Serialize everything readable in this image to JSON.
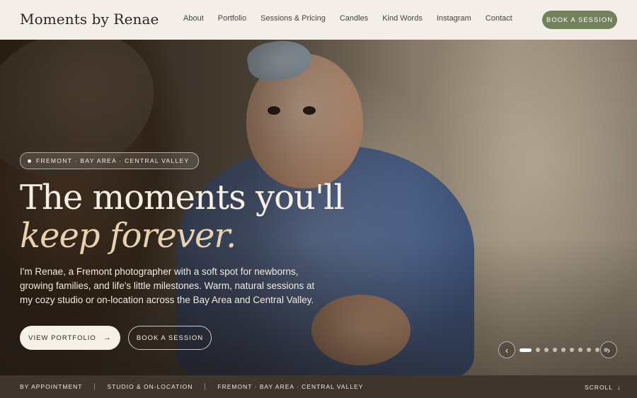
{
  "header": {
    "brand": "Moments by Renae",
    "nav": [
      "About",
      "Portfolio",
      "Sessions & Pricing",
      "Candles",
      "Kind Words",
      "Instagram",
      "Contact"
    ],
    "cta": "BOOK A SESSION"
  },
  "hero": {
    "location": "FREMONT · BAY AREA · CENTRAL VALLEY",
    "headline": "The moments you'll",
    "headline_italic": "keep forever.",
    "intro": "I'm Renae, a Fremont photographer with a soft spot for newborns, growing families, and life's little milestones. Warm, natural sessions at my cozy studio or on-location across the Bay Area and Central Valley.",
    "primary_button": "VIEW PORTFOLIO",
    "secondary_button": "BOOK A SESSION",
    "carousel": {
      "total": 10,
      "active_index": 0
    }
  },
  "bottom_bar": {
    "items": [
      "BY APPOINTMENT",
      "STUDIO & ON-LOCATION",
      "FREMONT · BAY AREA · CENTRAL VALLEY"
    ],
    "scroll": "SCROLL"
  },
  "colors": {
    "accent": "#71825a",
    "cream": "#f3efe8",
    "italic": "#e6d2b0",
    "bar": "#3e352c"
  }
}
